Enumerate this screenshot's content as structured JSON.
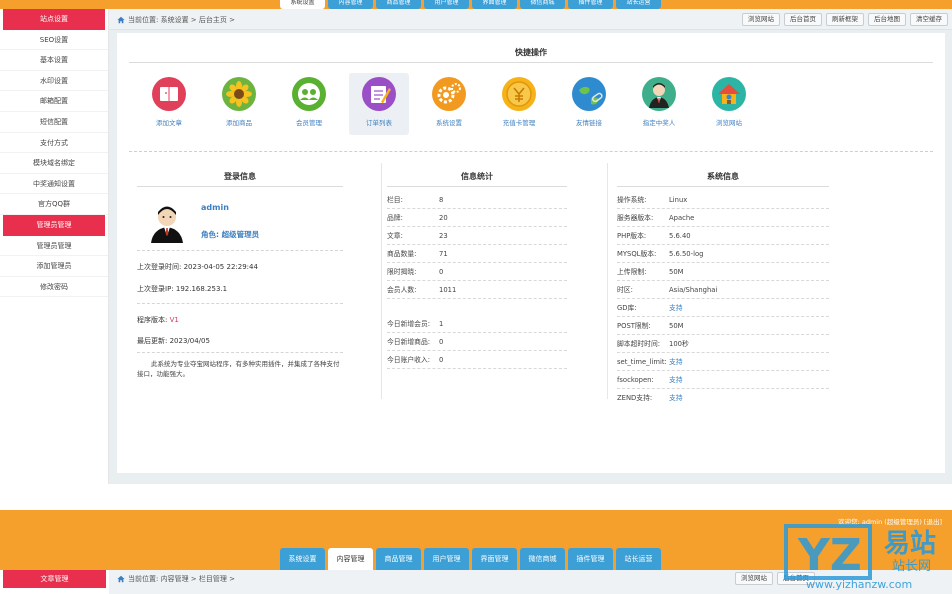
{
  "top_tabs": [
    "系统设置",
    "内容管理",
    "商品管理",
    "用户管理",
    "界面管理",
    "微信商城",
    "插件管理",
    "站长运营"
  ],
  "sidebar": {
    "items": [
      {
        "label": "站点设置",
        "active": true
      },
      {
        "label": "SEO设置"
      },
      {
        "label": "基本设置"
      },
      {
        "label": "水印设置"
      },
      {
        "label": "邮箱配置"
      },
      {
        "label": "短信配置"
      },
      {
        "label": "支付方式"
      },
      {
        "label": "模块域名绑定"
      },
      {
        "label": "中奖通知设置"
      },
      {
        "label": "官方QQ群"
      },
      {
        "label": "管理员管理",
        "active": true
      },
      {
        "label": "管理员管理"
      },
      {
        "label": "添加管理员"
      },
      {
        "label": "修改密码"
      }
    ]
  },
  "breadcrumb": "当前位置: 系统设置 > 后台主页 >",
  "header_buttons": [
    "浏览网站",
    "后台首页",
    "刷新框架",
    "后台地图",
    "清空缓存"
  ],
  "quick_actions": {
    "title": "快捷操作",
    "items": [
      {
        "label": "添加文章",
        "icon": "book-icon",
        "color": "#e0405a"
      },
      {
        "label": "添加商品",
        "icon": "sunflower-icon",
        "color": "#6cb33f"
      },
      {
        "label": "会员管理",
        "icon": "members-icon",
        "color": "#5ab030"
      },
      {
        "label": "订单列表",
        "icon": "order-list-icon",
        "color": "#9a4fc7"
      },
      {
        "label": "系统设置",
        "icon": "gear-icon",
        "color": "#f19a1f"
      },
      {
        "label": "充值卡管理",
        "icon": "coin-icon",
        "color": "#f5b219"
      },
      {
        "label": "友情链接",
        "icon": "globe-icon",
        "color": "#2e8bd0"
      },
      {
        "label": "指定中奖人",
        "icon": "person-icon",
        "color": "#3fae8a"
      },
      {
        "label": "浏览网站",
        "icon": "house-icon",
        "color": "#2cb5a5"
      }
    ]
  },
  "login_info": {
    "title": "登录信息",
    "username": "admin",
    "role": "角色: 超级管理员",
    "last_login_time": "上次登录时间: 2023-04-05 22:29:44",
    "last_login_ip": "上次登录IP: 192.168.253.1",
    "version_label": "程序版本: ",
    "version_value": "V1",
    "last_update": "最后更新: 2023/04/05",
    "description": "此系统为专业夺宝网站程序，有多种实用插件，并集成了各种支付接口，功能强大。"
  },
  "stats": {
    "title": "信息统计",
    "rows": [
      {
        "label": "栏目:",
        "value": "8"
      },
      {
        "label": "品牌:",
        "value": "20"
      },
      {
        "label": "文章:",
        "value": "23"
      },
      {
        "label": "商品数量:",
        "value": "71"
      },
      {
        "label": "限时揭晓:",
        "value": "0"
      },
      {
        "label": "会员人数:",
        "value": "1011"
      }
    ],
    "today_rows": [
      {
        "label": "今日新增会员:",
        "value": "1"
      },
      {
        "label": "今日新增商品:",
        "value": "0"
      },
      {
        "label": "今日账户收入:",
        "value": "0"
      }
    ]
  },
  "system_info": {
    "title": "系统信息",
    "rows": [
      {
        "label": "操作系统:",
        "value": "Linux"
      },
      {
        "label": "服务器版本:",
        "value": "Apache"
      },
      {
        "label": "PHP版本:",
        "value": "5.6.40"
      },
      {
        "label": "MYSQL版本:",
        "value": "5.6.50-log"
      },
      {
        "label": "上传限制:",
        "value": "50M"
      },
      {
        "label": "时区:",
        "value": "Asia/Shanghai"
      },
      {
        "label": "GD库:",
        "value": "支持",
        "link": true
      },
      {
        "label": "POST限制:",
        "value": "50M"
      },
      {
        "label": "脚本超时时间:",
        "value": "100秒"
      },
      {
        "label": "set_time_limit:",
        "value": "支持",
        "link": true
      },
      {
        "label": "fsockopen:",
        "value": "支持",
        "link": true
      },
      {
        "label": "ZEND支持:",
        "value": "支持",
        "link": true
      }
    ]
  },
  "panel2": {
    "welcome": "欢迎您: admin (超级管理员) [退出]",
    "tabs": [
      "系统设置",
      "内容管理",
      "商品管理",
      "用户管理",
      "界面管理",
      "微信商城",
      "插件管理",
      "站长运营"
    ],
    "active_tab": 1,
    "sidebar_label": "文章管理",
    "breadcrumb": "当前位置: 内容管理 > 栏目管理 >",
    "header_buttons": [
      "浏览网站",
      "后台首页"
    ]
  },
  "watermark": {
    "logo": "YZ",
    "title": "易站",
    "subtitle": "站长网",
    "url": "www.yizhanzw.com"
  },
  "colors": {
    "orange": "#f5a02d",
    "blue_tab": "#3c9fd6",
    "red_active": "#e8304e",
    "link": "#3c7fc1"
  }
}
